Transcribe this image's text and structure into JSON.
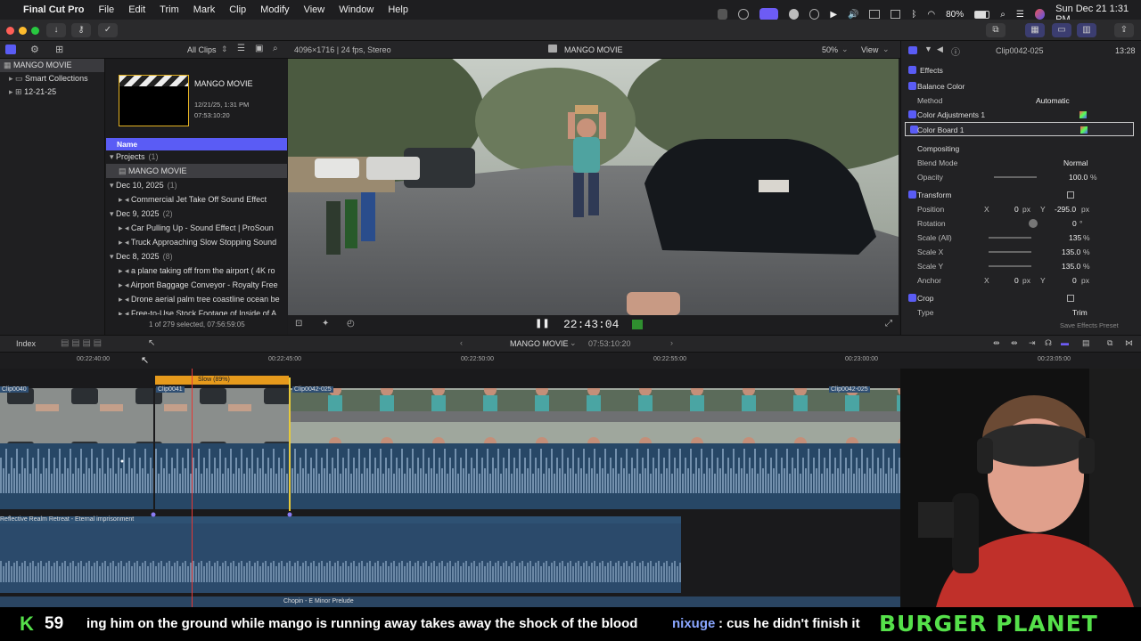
{
  "menubar": {
    "app": "Final Cut Pro",
    "items": [
      "File",
      "Edit",
      "Trim",
      "Mark",
      "Clip",
      "Modify",
      "View",
      "Window",
      "Help"
    ],
    "battery": "80%",
    "datetime": "Sun Dec 21  1:31 PM"
  },
  "library": {
    "name": "MANGO MOVIE",
    "items": [
      "Smart Collections",
      "12-21-25"
    ]
  },
  "browser_header": {
    "filter": "All Clips",
    "format": "4096×1716 | 24 fps, Stereo",
    "title": "MANGO MOVIE",
    "zoom": "50%",
    "view": "View"
  },
  "project_card": {
    "name": "MANGO MOVIE",
    "date": "12/21/25, 1:31 PM",
    "duration": "07:53:10:20"
  },
  "list": {
    "column": "Name",
    "rows": [
      {
        "type": "group",
        "label": "Projects",
        "count": "(1)"
      },
      {
        "type": "item",
        "label": "MANGO MOVIE",
        "selected": true
      },
      {
        "type": "group",
        "label": "Dec 10, 2025",
        "count": "(1)"
      },
      {
        "type": "item",
        "label": "Commercial Jet Take Off Sound Effect"
      },
      {
        "type": "group",
        "label": "Dec 9, 2025",
        "count": "(2)"
      },
      {
        "type": "item",
        "label": "Car Pulling Up - Sound Effect  |  ProSoun"
      },
      {
        "type": "item",
        "label": "Truck Approaching Slow Stopping Sound"
      },
      {
        "type": "group",
        "label": "Dec 8, 2025",
        "count": "(8)"
      },
      {
        "type": "item",
        "label": "a plane taking off from the airport ( 4K ro"
      },
      {
        "type": "item",
        "label": "Airport Baggage Conveyor - Royalty Free"
      },
      {
        "type": "item",
        "label": "Drone aerial palm tree coastline ocean be"
      },
      {
        "type": "item",
        "label": "Free-to-Use Stock Footage of Inside of A"
      }
    ],
    "status": "1 of 279 selected, 07:56:59:05"
  },
  "viewer": {
    "timecode": "22:43:04"
  },
  "inspector": {
    "clip": "Clip0042-025",
    "duration": "13:28",
    "effects": "Effects",
    "balance": "Balance Color",
    "method_label": "Method",
    "method_value": "Automatic",
    "adj": "Color Adjustments 1",
    "board": "Color Board 1",
    "compositing": "Compositing",
    "blend_label": "Blend Mode",
    "blend_value": "Normal",
    "opacity_label": "Opacity",
    "opacity_value": "100.0",
    "opacity_unit": "%",
    "transform": "Transform",
    "position_label": "Position",
    "pos_x": "0",
    "pos_y": "-295.0",
    "rotation_label": "Rotation",
    "rotation_value": "0",
    "scale_all_label": "Scale (All)",
    "scale_all": "135",
    "scale_x_label": "Scale X",
    "scale_x": "135.0",
    "scale_y_label": "Scale Y",
    "scale_y": "135.0",
    "anchor_label": "Anchor",
    "anchor_x": "0",
    "anchor_y": "0",
    "crop": "Crop",
    "type_label": "Type",
    "type_value": "Trim",
    "save_preset": "Save Effects Preset",
    "x": "X",
    "y": "Y",
    "px": "px",
    "deg": "°"
  },
  "timeline": {
    "index": "Index",
    "project": "MANGO MOVIE",
    "duration": "07:53:10:20",
    "ruler": [
      "00:22:40:00",
      "00:22:45:00",
      "00:22:50:00",
      "00:22:55:00",
      "00:23:00:00",
      "00:23:05:00"
    ],
    "retime": "Slow (89%)",
    "clips": [
      "Clip0040",
      "Clip0041",
      "Clip0042-025",
      "Clip0042-025"
    ],
    "music1": "Reflective Realm Retreat - Eternal imprisonment",
    "music2": "Chopin - E Minor Prelude"
  },
  "overlay": {
    "k": "K",
    "count": "59",
    "ticker": "ing him on the ground while mango is running away takes away the shock of the blood",
    "user": "nixuge",
    "msg": ": cus he didn't finish it",
    "brand": "BURGER PLANET"
  },
  "colors": {
    "accent": "#5a5cf5",
    "clip_blue": "#2f4f73",
    "retime": "#e69a1c",
    "playhead": "#e53935",
    "audio": "#6d8fb0",
    "banner_green": "#55e04a"
  }
}
